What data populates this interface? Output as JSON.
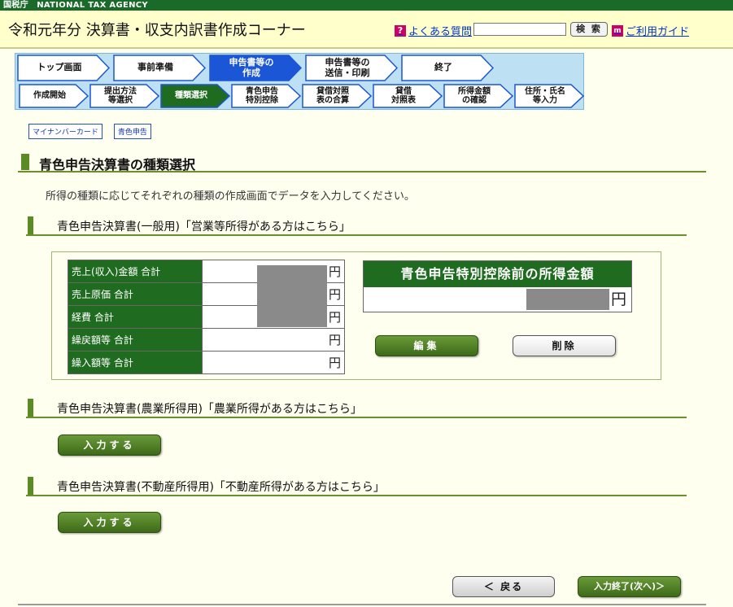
{
  "agency_bar": "国税庁　NATIONAL TAX AGENCY",
  "header": {
    "title": "令和元年分 決算書・収支内訳書作成コーナー",
    "faq_label": "よくある質問",
    "search_button": "検 索",
    "guide_label": "ご利用ガイド"
  },
  "nav": {
    "main_steps": [
      {
        "line1": "トップ画面",
        "line2": ""
      },
      {
        "line1": "事前準備",
        "line2": ""
      },
      {
        "line1": "申告書等の",
        "line2": "作成"
      },
      {
        "line1": "申告書等の",
        "line2": "送信・印刷"
      },
      {
        "line1": "終了",
        "line2": ""
      }
    ],
    "sub_steps": [
      {
        "line1": "作成開始",
        "line2": ""
      },
      {
        "line1": "提出方法",
        "line2": "等選択"
      },
      {
        "line1": "種類選択",
        "line2": ""
      },
      {
        "line1": "青色申告",
        "line2": "特別控除"
      },
      {
        "line1": "貸借対照",
        "line2": "表の合算"
      },
      {
        "line1": "貸借",
        "line2": "対照表"
      },
      {
        "line1": "所得金額",
        "line2": "の確認"
      },
      {
        "line1": "住所・氏名",
        "line2": "等入力"
      }
    ],
    "active_main": 2,
    "active_sub": 2
  },
  "badges": [
    "マイナンバーカード",
    "青色申告"
  ],
  "page": {
    "heading": "青色申告決算書の種類選択",
    "intro": "所得の種類に応じてそれぞれの種類の作成画面でデータを入力してください。"
  },
  "general": {
    "heading": "青色申告決算書(一般用)「営業等所得がある方はこちら」",
    "rows": [
      {
        "label": "売上(収入)金額 合計",
        "unit": "円"
      },
      {
        "label": "売上原価 合計",
        "unit": "円"
      },
      {
        "label": "経費 合計",
        "unit": "円"
      },
      {
        "label": "繰戻額等 合計",
        "unit": "円"
      },
      {
        "label": "繰入額等 合計",
        "unit": "円"
      }
    ],
    "summary_title": "青色申告特別控除前の所得金額",
    "summary_unit": "円",
    "edit_button": "編集",
    "delete_button": "削除"
  },
  "agriculture": {
    "heading": "青色申告決算書(農業所得用)「農業所得がある方はこちら」",
    "input_button": "入力する"
  },
  "realestate": {
    "heading": "青色申告決算書(不動産所得用)「不動産所得がある方はこちら」",
    "input_button": "入力する"
  },
  "footer": {
    "back_button": "＜ 戻る",
    "next_button": "入力終了(次へ)＞"
  },
  "colors": {
    "brand_green": "#1f6b20",
    "active_step_blue": "#1a56d6",
    "header_yellow": "#ffffcc"
  }
}
